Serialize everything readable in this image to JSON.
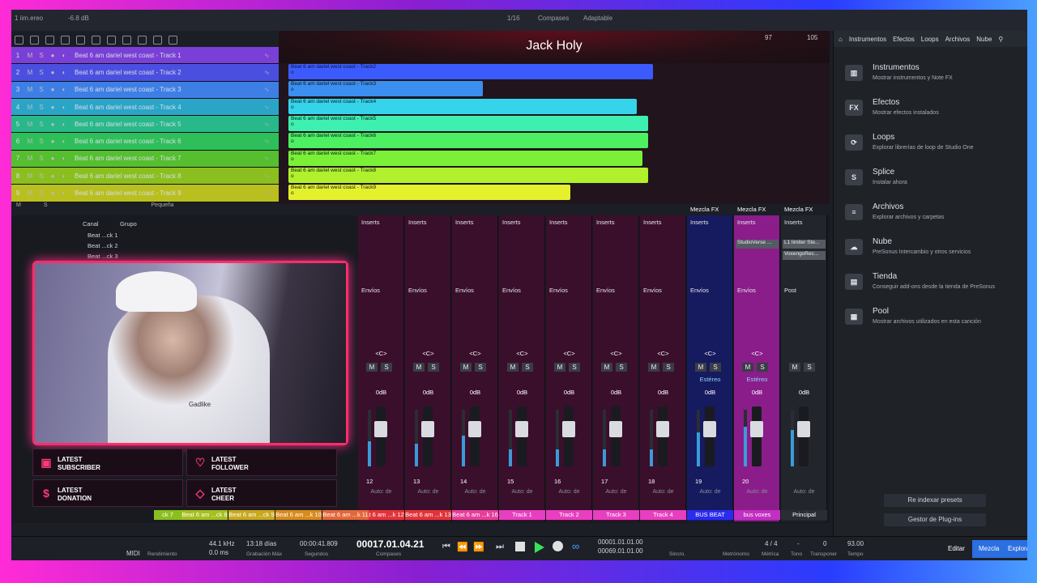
{
  "topbar": {
    "left": "1 iim.ereo",
    "db": "-6.8 dB",
    "snap": "1/16",
    "timebase": "Compases",
    "quantize": "Adaptable"
  },
  "title": "Jack Holy",
  "ruler": {
    "mark1": "97",
    "mark2": "105"
  },
  "tracks": [
    {
      "num": "1",
      "name": "Beat 6 am dariel west coast - Track 1",
      "color": "#7a3fd6"
    },
    {
      "num": "2",
      "name": "Beat 6 am dariel west coast - Track 2",
      "color": "#4b4fe0"
    },
    {
      "num": "3",
      "name": "Beat 6 am dariel west coast - Track 3",
      "color": "#3e7fe6"
    },
    {
      "num": "4",
      "name": "Beat 6 am dariel west coast - Track 4",
      "color": "#2aa5c8"
    },
    {
      "num": "5",
      "name": "Beat 6 am dariel west coast - Track 5",
      "color": "#29b88a"
    },
    {
      "num": "6",
      "name": "Beat 6 am dariel west coast - Track 6",
      "color": "#2fbf5a"
    },
    {
      "num": "7",
      "name": "Beat 6 am dariel west coast - Track 7",
      "color": "#55bf2f"
    },
    {
      "num": "8",
      "name": "Beat 6 am dariel west coast - Track 8",
      "color": "#8bbf1f"
    },
    {
      "num": "9",
      "name": "Beat 6 am dariel west coast - Track 9",
      "color": "#b8bf1f"
    }
  ],
  "track_buttons": {
    "m": "M",
    "s": "S",
    "rec": "●",
    "mon": "◐"
  },
  "clips": [
    {
      "label": "Beat 6 am dariel west coast - Track2",
      "sub": "o",
      "color": "#3b5bff",
      "end": 0.68
    },
    {
      "label": "Beat 6 am dariel west coast - Track3",
      "sub": "o",
      "color": "#3a8ff0",
      "end": 0.37
    },
    {
      "label": "Beat 6 am dariel west coast - Track4",
      "sub": "o",
      "color": "#36d4ea",
      "end": 0.65
    },
    {
      "label": "Beat 6 am dariel west coast - Track5",
      "sub": "o",
      "color": "#3ef0b0",
      "end": 0.67
    },
    {
      "label": "Beat 6 am dariel west coast - Track6",
      "sub": "o",
      "color": "#4cf061",
      "end": 0.67
    },
    {
      "label": "Beat 6 am dariel west coast - Track7",
      "sub": "o",
      "color": "#7af037",
      "end": 0.66
    },
    {
      "label": "Beat 6 am dariel west coast - Track8",
      "sub": "o",
      "color": "#b0f02c",
      "end": 0.67
    },
    {
      "label": "Beat 6 am dariel west coast - Track9",
      "sub": "o",
      "color": "#e4f02c",
      "end": 0.53
    }
  ],
  "arrange_status": {
    "m": "M",
    "s": "S",
    "size": "Pequeña"
  },
  "browser": {
    "tabs": [
      "Instrumentos",
      "Efectos",
      "Loops",
      "Archivos",
      "Nube"
    ],
    "items": [
      {
        "icon": "piano-icon",
        "glyph": "▥",
        "title": "Instrumentos",
        "desc": "Mostrar instrumentos y Note FX"
      },
      {
        "icon": "fx-icon",
        "glyph": "FX",
        "title": "Efectos",
        "desc": "Mostrar efectos instalados"
      },
      {
        "icon": "loops-icon",
        "glyph": "⟳",
        "title": "Loops",
        "desc": "Explorar librerías de loop de Studio One"
      },
      {
        "icon": "splice-icon",
        "glyph": "S",
        "title": "Splice",
        "desc": "Instalar ahora"
      },
      {
        "icon": "files-icon",
        "glyph": "≡",
        "title": "Archivos",
        "desc": "Explorar archivos y carpetas"
      },
      {
        "icon": "cloud-icon",
        "glyph": "☁",
        "title": "Nube",
        "desc": "PreSonus Intercambio y otros servicios"
      },
      {
        "icon": "shop-icon",
        "glyph": "▤",
        "title": "Tienda",
        "desc": "Conseguir add-ons desde la tienda de PreSonus"
      },
      {
        "icon": "pool-icon",
        "glyph": "▦",
        "title": "Pool",
        "desc": "Mostrar archivos utilizados en esta canción"
      }
    ],
    "reindex": "Re indexar presets",
    "plugins": "Gestor de Plug-ins"
  },
  "channel_list": {
    "col1": "Canal",
    "col2": "Grupo",
    "rows": [
      "Beat ...ck 1",
      "Beat ...ck 2",
      "Beat ...ck 3"
    ]
  },
  "channels": [
    {
      "num": "12",
      "name": "Beat 6 am ...k 12",
      "color": "#3a0f2c",
      "label_bg": "#e3333a",
      "meter": 0.45
    },
    {
      "num": "13",
      "name": "Beat 6 am ...k 13",
      "color": "#3a0f2c",
      "label_bg": "#e3333a",
      "meter": 0.4
    },
    {
      "num": "14",
      "name": "Beat 6 am ...k 16",
      "color": "#3a0f2c",
      "label_bg": "#e63f9a",
      "meter": 0.55
    },
    {
      "num": "15",
      "name": "Track 1",
      "color": "#3a0f2c",
      "label_bg": "#e63fc0",
      "meter": 0.3
    },
    {
      "num": "16",
      "name": "Track 2",
      "color": "#3a0f2c",
      "label_bg": "#e63fc0",
      "meter": 0.3
    },
    {
      "num": "17",
      "name": "Track 3",
      "color": "#3a0f2c",
      "label_bg": "#e63fc0",
      "meter": 0.3
    },
    {
      "num": "18",
      "name": "Track 4",
      "color": "#3a0f2c",
      "label_bg": "#e63fc0",
      "meter": 0.3
    },
    {
      "num": "19",
      "name": "BUS BEAT",
      "color": "#161a5e",
      "label_bg": "#2b2bf0",
      "meter": 0.6,
      "mixfx": "Mezcla FX",
      "stereo": "Estéreo"
    },
    {
      "num": "20",
      "name": "bus voxes",
      "color": "#8a1d8a",
      "label_bg": "#c22fc2",
      "meter": 0.7,
      "mixfx": "Mezcla FX",
      "stereo": "Estéreo",
      "fx1": "StudioVerse ..."
    },
    {
      "num": "",
      "name": "Principal",
      "color": "#22252c",
      "label_bg": "#2a2d34",
      "meter": 0.65,
      "mixfx": "Mezcla FX",
      "fx1": "L1 limiter Ste...",
      "fx2": "VoxengoRec..."
    }
  ],
  "channel_common": {
    "inserts": "Inserts",
    "sends": "Envíos",
    "post": "Post",
    "pan": "<C>",
    "db": "0dB",
    "auto": "Auto: de",
    "m": "M",
    "s": "S"
  },
  "left_labels": [
    "ck 7",
    "Beat 6 am ...ck 8",
    "Beat 6 am ...ck 9",
    "Beat 6 am ...k 10",
    "Beat 6 am ...k 11"
  ],
  "webcam": {
    "shirt_text": "Gadlike"
  },
  "alerts": [
    {
      "icon": "twitch-icon",
      "glyph": "▣",
      "line1": "LATEST",
      "line2": "SUBSCRIBER"
    },
    {
      "icon": "heart-icon",
      "glyph": "♡",
      "line1": "LATEST",
      "line2": "FOLLOWER"
    },
    {
      "icon": "dollar-icon",
      "glyph": "$",
      "line1": "LATEST",
      "line2": "DONATION"
    },
    {
      "icon": "diamond-icon",
      "glyph": "◇",
      "line1": "LATEST",
      "line2": "CHEER"
    }
  ],
  "transport": {
    "midi": "MIDI",
    "render": "Rendimiento",
    "rate": "44.1 kHz",
    "latency": "0.0 ms",
    "rec_days": "13:18 días",
    "rec_label": "Grabación Máx",
    "seconds": "00:00:41.809",
    "seconds_label": "Segundos",
    "position": "00017.01.04.21",
    "position_label": "Compases",
    "loop_l": "00001.01.01.00",
    "loop_r": "00069.01.01.00",
    "sync": "Sincro.",
    "metro": "Metrónomo",
    "meter": "4 / 4",
    "meter_label": "Métrica",
    "key": "-",
    "key_label": "Tono",
    "transpose": "0",
    "transpose_label": "Transponer",
    "tempo": "93.00",
    "tempo_label": "Tempo",
    "edit": "Editar",
    "mix": "Mezcla",
    "browse": "Explora"
  },
  "colors": {
    "accent_green": "#39e15a",
    "neon_pink": "#ff2d6a",
    "mix_tab": "#2b6fe0"
  }
}
